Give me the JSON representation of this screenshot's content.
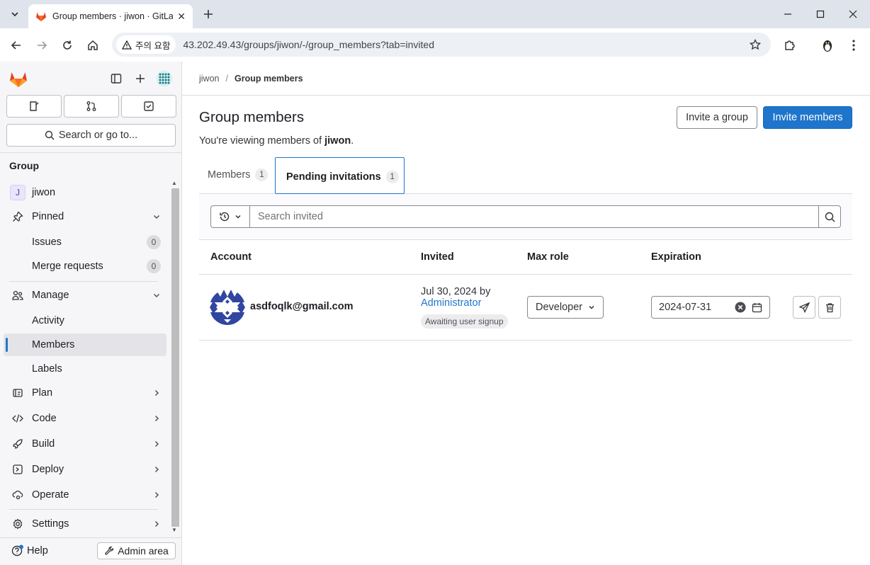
{
  "browser": {
    "tab_title": "Group members · jiwon · GitLab",
    "security_label": "주의 요함",
    "url": "43.202.49.43/groups/jiwon/-/group_members?tab=invited"
  },
  "sidebar": {
    "search_label": "Search or go to...",
    "section_title": "Group",
    "group_initial": "J",
    "group_name": "jiwon",
    "pinned": {
      "label": "Pinned",
      "items": [
        {
          "label": "Issues",
          "count": "0"
        },
        {
          "label": "Merge requests",
          "count": "0"
        }
      ]
    },
    "manage": {
      "label": "Manage",
      "items": [
        {
          "label": "Activity"
        },
        {
          "label": "Members"
        },
        {
          "label": "Labels"
        }
      ]
    },
    "sections": [
      {
        "label": "Plan"
      },
      {
        "label": "Code"
      },
      {
        "label": "Build"
      },
      {
        "label": "Deploy"
      },
      {
        "label": "Operate"
      },
      {
        "label": "Settings"
      }
    ],
    "help_label": "Help",
    "admin_label": "Admin area"
  },
  "breadcrumb": {
    "group": "jiwon",
    "current": "Group members"
  },
  "page": {
    "title": "Group members",
    "invite_group_label": "Invite a group",
    "invite_members_label": "Invite members",
    "subtitle_prefix": "You're viewing members of ",
    "subtitle_group": "jiwon",
    "subtitle_suffix": "."
  },
  "tabs": [
    {
      "label": "Members",
      "count": "1"
    },
    {
      "label": "Pending invitations",
      "count": "1"
    }
  ],
  "filter": {
    "placeholder": "Search invited"
  },
  "table": {
    "columns": [
      "Account",
      "Invited",
      "Max role",
      "Expiration"
    ],
    "rows": [
      {
        "account": "asdfoqlk@gmail.com",
        "invited_date": "Jul 30, 2024 by",
        "invited_by": "Administrator",
        "status": "Awaiting user signup",
        "role": "Developer",
        "expiration": "2024-07-31"
      }
    ]
  },
  "colors": {
    "primary": "#1f75cb",
    "gitlab_orange": "#e24329"
  }
}
